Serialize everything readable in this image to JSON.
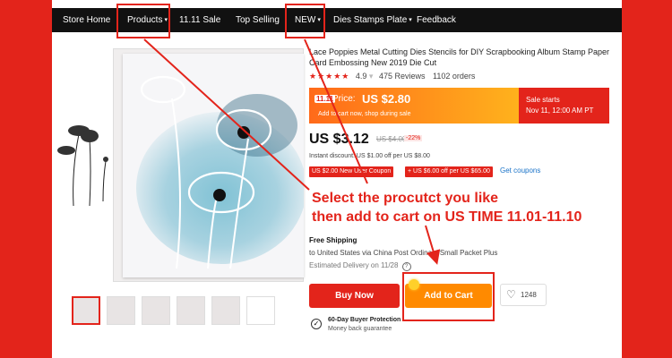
{
  "nav": {
    "items": [
      {
        "label": "Store Home",
        "chev": ""
      },
      {
        "label": "Products",
        "chev": "▾"
      },
      {
        "label": "11.11 Sale",
        "chev": ""
      },
      {
        "label": "Top Selling",
        "chev": ""
      },
      {
        "label": "NEW",
        "chev": "▾"
      },
      {
        "label": "Dies Stamps Plate",
        "chev": "▾"
      },
      {
        "label": "Feedback",
        "chev": ""
      }
    ]
  },
  "product": {
    "title": "Lace Poppies Metal Cutting Dies Stencils for DIY Scrapbooking Album Stamp Paper Card Embossing New 2019 Die Cut",
    "rating": "4.9",
    "reviews": "475 Reviews",
    "orders": "1102 orders"
  },
  "promo": {
    "badge": "11.11",
    "price_label": "Price:",
    "price": "US $2.80",
    "subtext": "Add to cart now, shop during sale",
    "sale_starts": "Sale starts",
    "sale_date": "Nov 11, 12:00 AM PT"
  },
  "pricing": {
    "current": "US $3.12",
    "original": "US $4.00",
    "discount": "-22%",
    "instant": "Instant discount: US $1.00 off per US $8.00",
    "coupon1": "US $2.00 New User Coupon",
    "coupon2": "+ US $6.00 off per US $65.00",
    "get_coupons": "Get coupons"
  },
  "annotation": {
    "line1": "Select the procutct you like",
    "line2": "then add to cart on US TIME 11.01-11.10"
  },
  "shipping": {
    "title": "Free Shipping",
    "detail": "to United States via China Post Ordinary Small Packet Plus",
    "delivery": "Estimated Delivery on 11/28"
  },
  "actions": {
    "buy_now": "Buy Now",
    "add_to_cart": "Add to Cart",
    "wishlist_count": "1248"
  },
  "protection": {
    "title": "60-Day Buyer Protection",
    "subtitle": "Money back guarantee"
  },
  "colors": {
    "accent": "#e3241b",
    "orange": "#ff8a00"
  }
}
